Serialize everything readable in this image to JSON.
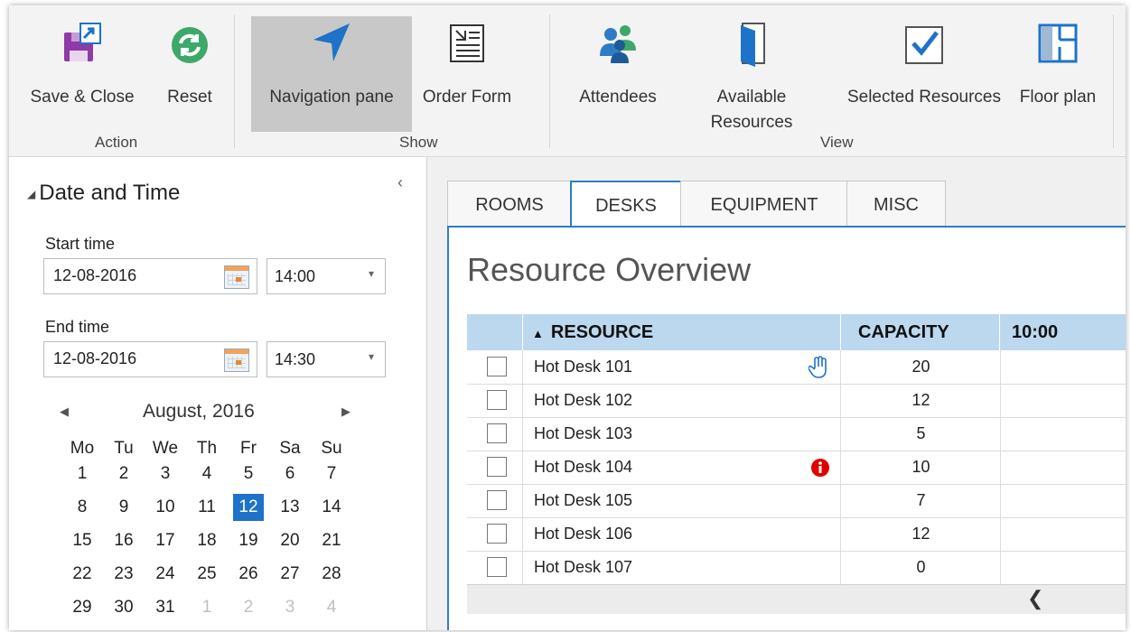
{
  "ribbon": {
    "buttons": [
      {
        "label": "Save & Close",
        "icon": "save-close-icon"
      },
      {
        "label": "Reset",
        "icon": "reset-icon"
      },
      {
        "label": "Navigation pane",
        "icon": "navigation-arrow-icon",
        "active": true
      },
      {
        "label": "Order Form",
        "icon": "order-form-icon"
      },
      {
        "label": "Attendees",
        "icon": "attendees-icon"
      },
      {
        "label": "Available Resources",
        "icon": "door-icon"
      },
      {
        "label": "Selected Resources",
        "icon": "checkbox-icon"
      },
      {
        "label": "Floor plan",
        "icon": "floor-plan-icon"
      }
    ],
    "groups": [
      "Action",
      "Show",
      "View"
    ]
  },
  "left": {
    "section_title": "Date and Time",
    "start_label": "Start time",
    "start_date": "12-08-2016",
    "start_time": "14:00",
    "end_label": "End time",
    "end_date": "12-08-2016",
    "end_time": "14:30",
    "calendar": {
      "month": "August, 2016",
      "weekdays": [
        "Mo",
        "Tu",
        "We",
        "Th",
        "Fr",
        "Sa",
        "Su"
      ],
      "weeks": [
        [
          "1",
          "2",
          "3",
          "4",
          "5",
          "6",
          "7"
        ],
        [
          "8",
          "9",
          "10",
          "11",
          "12",
          "13",
          "14"
        ],
        [
          "15",
          "16",
          "17",
          "18",
          "19",
          "20",
          "21"
        ],
        [
          "22",
          "23",
          "24",
          "25",
          "26",
          "27",
          "28"
        ],
        [
          "29",
          "30",
          "31",
          "1",
          "2",
          "3",
          "4"
        ]
      ],
      "selected": "12"
    }
  },
  "tabs": [
    "ROOMS",
    "DESKS",
    "EQUIPMENT",
    "MISC"
  ],
  "active_tab": "DESKS",
  "overview": {
    "title": "Resource Overview",
    "columns": [
      "RESOURCE",
      "CAPACITY",
      "10:00"
    ],
    "rows": [
      {
        "name": "Hot Desk 101",
        "capacity": "20",
        "icon": "hand-icon"
      },
      {
        "name": "Hot Desk 102",
        "capacity": "12",
        "icon": ""
      },
      {
        "name": "Hot Desk 103",
        "capacity": "5",
        "icon": ""
      },
      {
        "name": "Hot Desk 104",
        "capacity": "10",
        "icon": "info-icon"
      },
      {
        "name": "Hot Desk 105",
        "capacity": "7",
        "icon": ""
      },
      {
        "name": "Hot Desk 106",
        "capacity": "12",
        "icon": ""
      },
      {
        "name": "Hot Desk 107",
        "capacity": "0",
        "icon": ""
      }
    ]
  },
  "colors": {
    "accent": "#2f7cc4",
    "header_bg": "#bcd8ef",
    "selected_day": "#1e72c8",
    "info": "#e00000"
  }
}
